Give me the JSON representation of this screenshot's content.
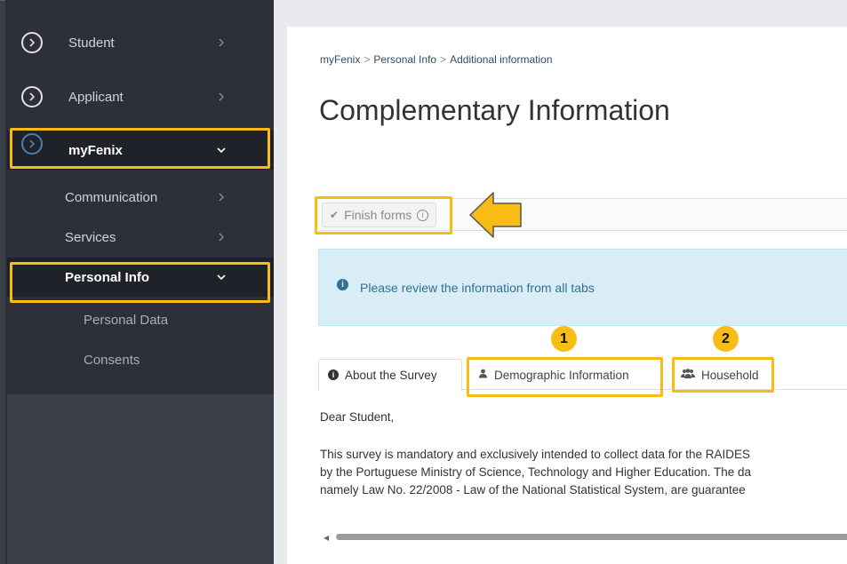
{
  "sidebar": {
    "items": [
      {
        "label": "Student",
        "icon": "chevron-circle-right-icon"
      },
      {
        "label": "Applicant",
        "icon": "chevron-circle-right-icon"
      },
      {
        "label": "myFenix",
        "icon": "chevron-circle-right-icon"
      }
    ],
    "sub_items": [
      {
        "label": "Communication"
      },
      {
        "label": "Services"
      },
      {
        "label": "Personal Info"
      }
    ],
    "subsub_items": [
      {
        "label": "Personal Data"
      },
      {
        "label": "Consents"
      }
    ]
  },
  "breadcrumb": {
    "items": [
      "myFenix",
      "Personal Info",
      "Additional information"
    ],
    "separator": ">"
  },
  "page": {
    "title": "Complementary Information"
  },
  "toolbar": {
    "finish_label": "Finish forms",
    "finish_icon": "check-icon",
    "info_icon": "info-circle-icon"
  },
  "alert": {
    "text": "Please review the information from all tabs",
    "icon": "info-icon"
  },
  "tabs": [
    {
      "label": "About the Survey",
      "icon": "info-circle-icon",
      "active": true
    },
    {
      "label": "Demographic Information",
      "icon": "user-icon",
      "badge": "1"
    },
    {
      "label": "Household",
      "icon": "users-icon",
      "badge": "2"
    }
  ],
  "content": {
    "greeting": "Dear Student,",
    "lines": [
      "This survey is mandatory and exclusively intended to collect data for the RAIDES",
      "by the Portuguese Ministry of Science, Technology and Higher Education. The da",
      "namely Law No. 22/2008 - Law of the National Statistical System, are guarantee"
    ]
  },
  "colors": {
    "highlight": "#f9bc15",
    "sidebar_bg": "#2d3039",
    "alert_bg": "#d9edf7",
    "alert_text": "#31708f"
  }
}
